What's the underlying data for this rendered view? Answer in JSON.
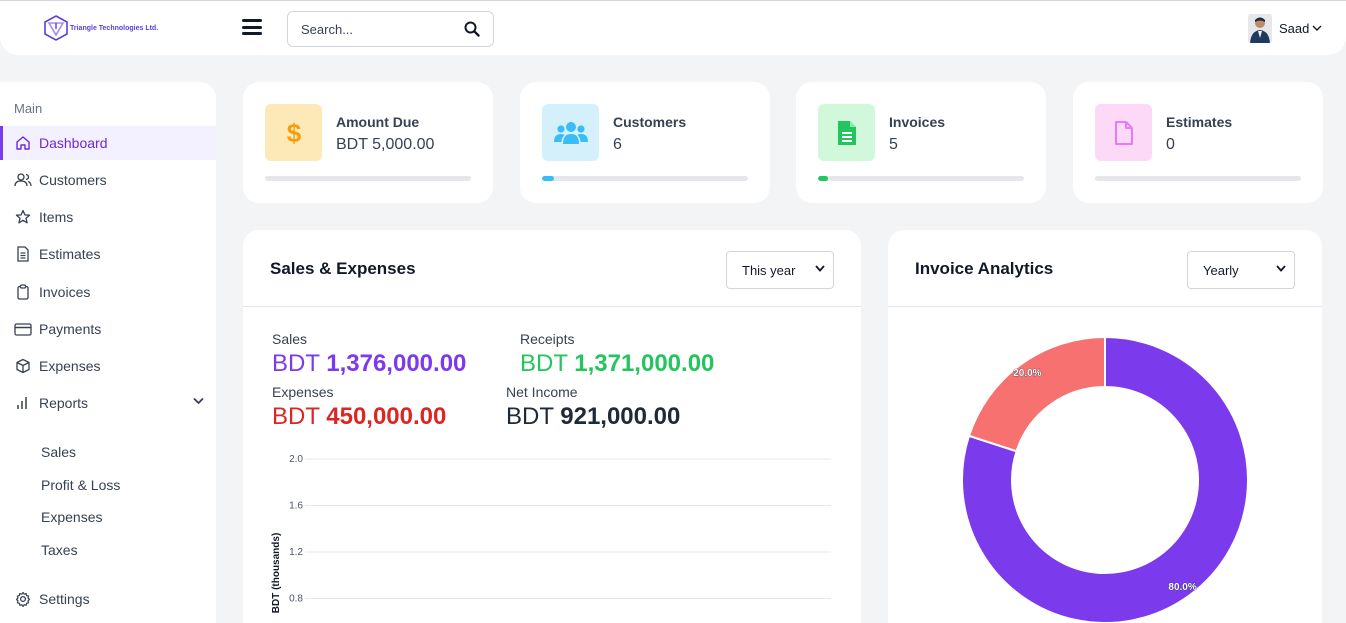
{
  "header": {
    "logo_text": "Triangle Technologies Ltd.",
    "search_placeholder": "Search...",
    "user_name": "Saad"
  },
  "sidebar": {
    "section": "Main",
    "items": [
      {
        "label": "Dashboard",
        "icon": "home-icon",
        "active": true
      },
      {
        "label": "Customers",
        "icon": "users-icon"
      },
      {
        "label": "Items",
        "icon": "star-icon"
      },
      {
        "label": "Estimates",
        "icon": "document-icon"
      },
      {
        "label": "Invoices",
        "icon": "clipboard-icon"
      },
      {
        "label": "Payments",
        "icon": "credit-card-icon"
      },
      {
        "label": "Expenses",
        "icon": "box-icon"
      },
      {
        "label": "Reports",
        "icon": "bar-chart-icon"
      }
    ],
    "reports_sub": [
      "Sales",
      "Profit & Loss",
      "Expenses",
      "Taxes"
    ],
    "settings_label": "Settings"
  },
  "stats": [
    {
      "label": "Amount Due",
      "value": "BDT 5,000.00",
      "icon": "dollar-icon",
      "progress": 0,
      "tile_color": "#fde9b8",
      "accent": "#f59e0b"
    },
    {
      "label": "Customers",
      "value": "6",
      "icon": "users-group-icon",
      "progress": 0.06,
      "tile_color": "#d4f1fb",
      "accent": "#38bdf8"
    },
    {
      "label": "Invoices",
      "value": "5",
      "icon": "invoice-file-icon",
      "progress": 0.05,
      "tile_color": "#d2f8dc",
      "accent": "#22c55e"
    },
    {
      "label": "Estimates",
      "value": "0",
      "icon": "blank-file-icon",
      "progress": 0,
      "tile_color": "#fcd9f7",
      "accent": "#e879f9"
    }
  ],
  "sales_panel": {
    "title": "Sales & Expenses",
    "period": "This year",
    "metrics": {
      "sales_label": "Sales",
      "sales_currency": "BDT",
      "sales_amount": "1,376,000.00",
      "receipts_label": "Receipts",
      "receipts_currency": "BDT",
      "receipts_amount": "1,371,000.00",
      "expenses_label": "Expenses",
      "expenses_currency": "BDT",
      "expenses_amount": "450,000.00",
      "net_label": "Net Income",
      "net_currency": "BDT",
      "net_amount": "921,000.00"
    },
    "colors": {
      "sales": "#7c3aed",
      "receipts": "#22c55e",
      "expenses": "#dc2626",
      "net": "#1f2937"
    }
  },
  "analytics_panel": {
    "title": "Invoice Analytics",
    "period": "Yearly"
  },
  "chart_data": [
    {
      "type": "line",
      "ylabel": "BDT (thousands)",
      "ytick_labels": [
        "2.0",
        "1.6",
        "1.2",
        "0.8"
      ],
      "ylim_visible": [
        0.8,
        2.0
      ],
      "grid": true,
      "series": []
    },
    {
      "type": "pie",
      "donut": true,
      "slices": [
        {
          "value": 80.0,
          "label": "80.0%",
          "color": "#7c3aed"
        },
        {
          "value": 20.0,
          "label": "20.0%",
          "color": "#f87171"
        }
      ]
    }
  ]
}
